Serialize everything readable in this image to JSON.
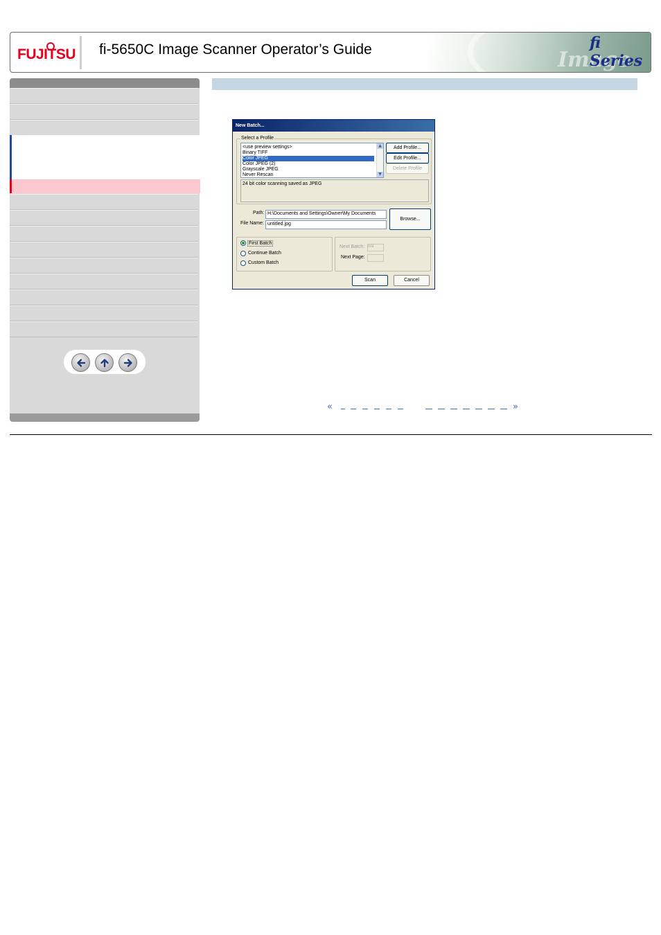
{
  "header": {
    "brand": "FUJITSU",
    "title": "fi-5650C Image Scanner Operator’s Guide",
    "series_logo": "fi Series",
    "banner_word": "Image Scanner"
  },
  "nav_buttons": {
    "back": "arrow-left-icon",
    "up": "arrow-up-icon",
    "forward": "arrow-right-icon"
  },
  "dialog": {
    "title": "New Batch...",
    "profile_group_label": "Select a Profile",
    "profiles": [
      "<use preview settings>",
      "Binary TIFF",
      "Color JPEG",
      "Color JPEG (2)",
      "Grayscale JPEG",
      "Never Rescan"
    ],
    "selected_profile_index": 2,
    "add_profile": "Add Profile...",
    "edit_profile": "Edit Profile...",
    "delete_profile": "Delete Profile",
    "description": "24 bit color scanning saved as JPEG",
    "path_label": "Path:",
    "path_value": "H:\\Documents and Settings\\Owner\\My Documents",
    "filename_label": "File Name:",
    "filename_value": "untitled.jpg",
    "browse": "Browse...",
    "radio_first": "First Batch",
    "radio_continue": "Continue Batch",
    "radio_custom": "Custom Batch",
    "next_batch_label": "Next Batch:",
    "next_batch_value": "n/a",
    "next_page_label": "Next Page:",
    "next_page_value": "",
    "scan": "Scan",
    "cancel": "Cancel"
  },
  "page_nav": {
    "prev_glyph": "«",
    "next_glyph": "»"
  },
  "colors": {
    "brand_red": "#e8001c",
    "content_bar": "#c4d6e3",
    "active_item": "#fcc8d0",
    "link_blue": "#3a6fb0"
  }
}
